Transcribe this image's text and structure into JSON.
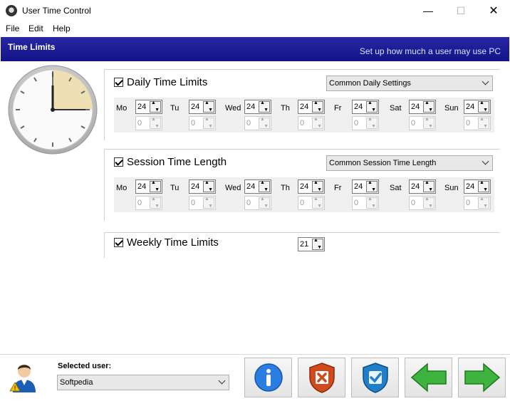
{
  "window": {
    "title": "User Time Control",
    "min_glyph": "—",
    "max_glyph": "☐",
    "close_glyph": "✕"
  },
  "menu": {
    "items": [
      "File",
      "Edit",
      "Help"
    ]
  },
  "banner": {
    "title": "Time Limits",
    "subtitle": "Set up how much a user may use PC"
  },
  "days": [
    "Mo",
    "Tu",
    "Wed",
    "Th",
    "Fr",
    "Sat",
    "Sun"
  ],
  "daily": {
    "label": "Daily Time Limits",
    "checked": true,
    "preset": "Common Daily Settings",
    "hours": [
      "24",
      "24",
      "24",
      "24",
      "24",
      "24",
      "24"
    ],
    "minutes": [
      "0",
      "0",
      "0",
      "0",
      "0",
      "0",
      "0"
    ]
  },
  "session": {
    "label": "Session Time Length",
    "checked": true,
    "preset": "Common Session Time Length",
    "hours": [
      "24",
      "24",
      "24",
      "24",
      "24",
      "24",
      "24"
    ],
    "minutes": [
      "0",
      "0",
      "0",
      "0",
      "0",
      "0",
      "0"
    ]
  },
  "weekly": {
    "label": "Weekly Time Limits",
    "checked": true,
    "value": "21"
  },
  "footer": {
    "selected_user_label": "Selected user:",
    "selected_user": "Softpedia"
  },
  "colors": {
    "banner": "#1c1c94",
    "banner_text": "#ffffff"
  },
  "icons": [
    "clock-icon",
    "user-warning-icon",
    "info-icon",
    "shield-cancel-icon",
    "shield-ok-icon",
    "back-arrow-icon",
    "forward-arrow-icon"
  ]
}
